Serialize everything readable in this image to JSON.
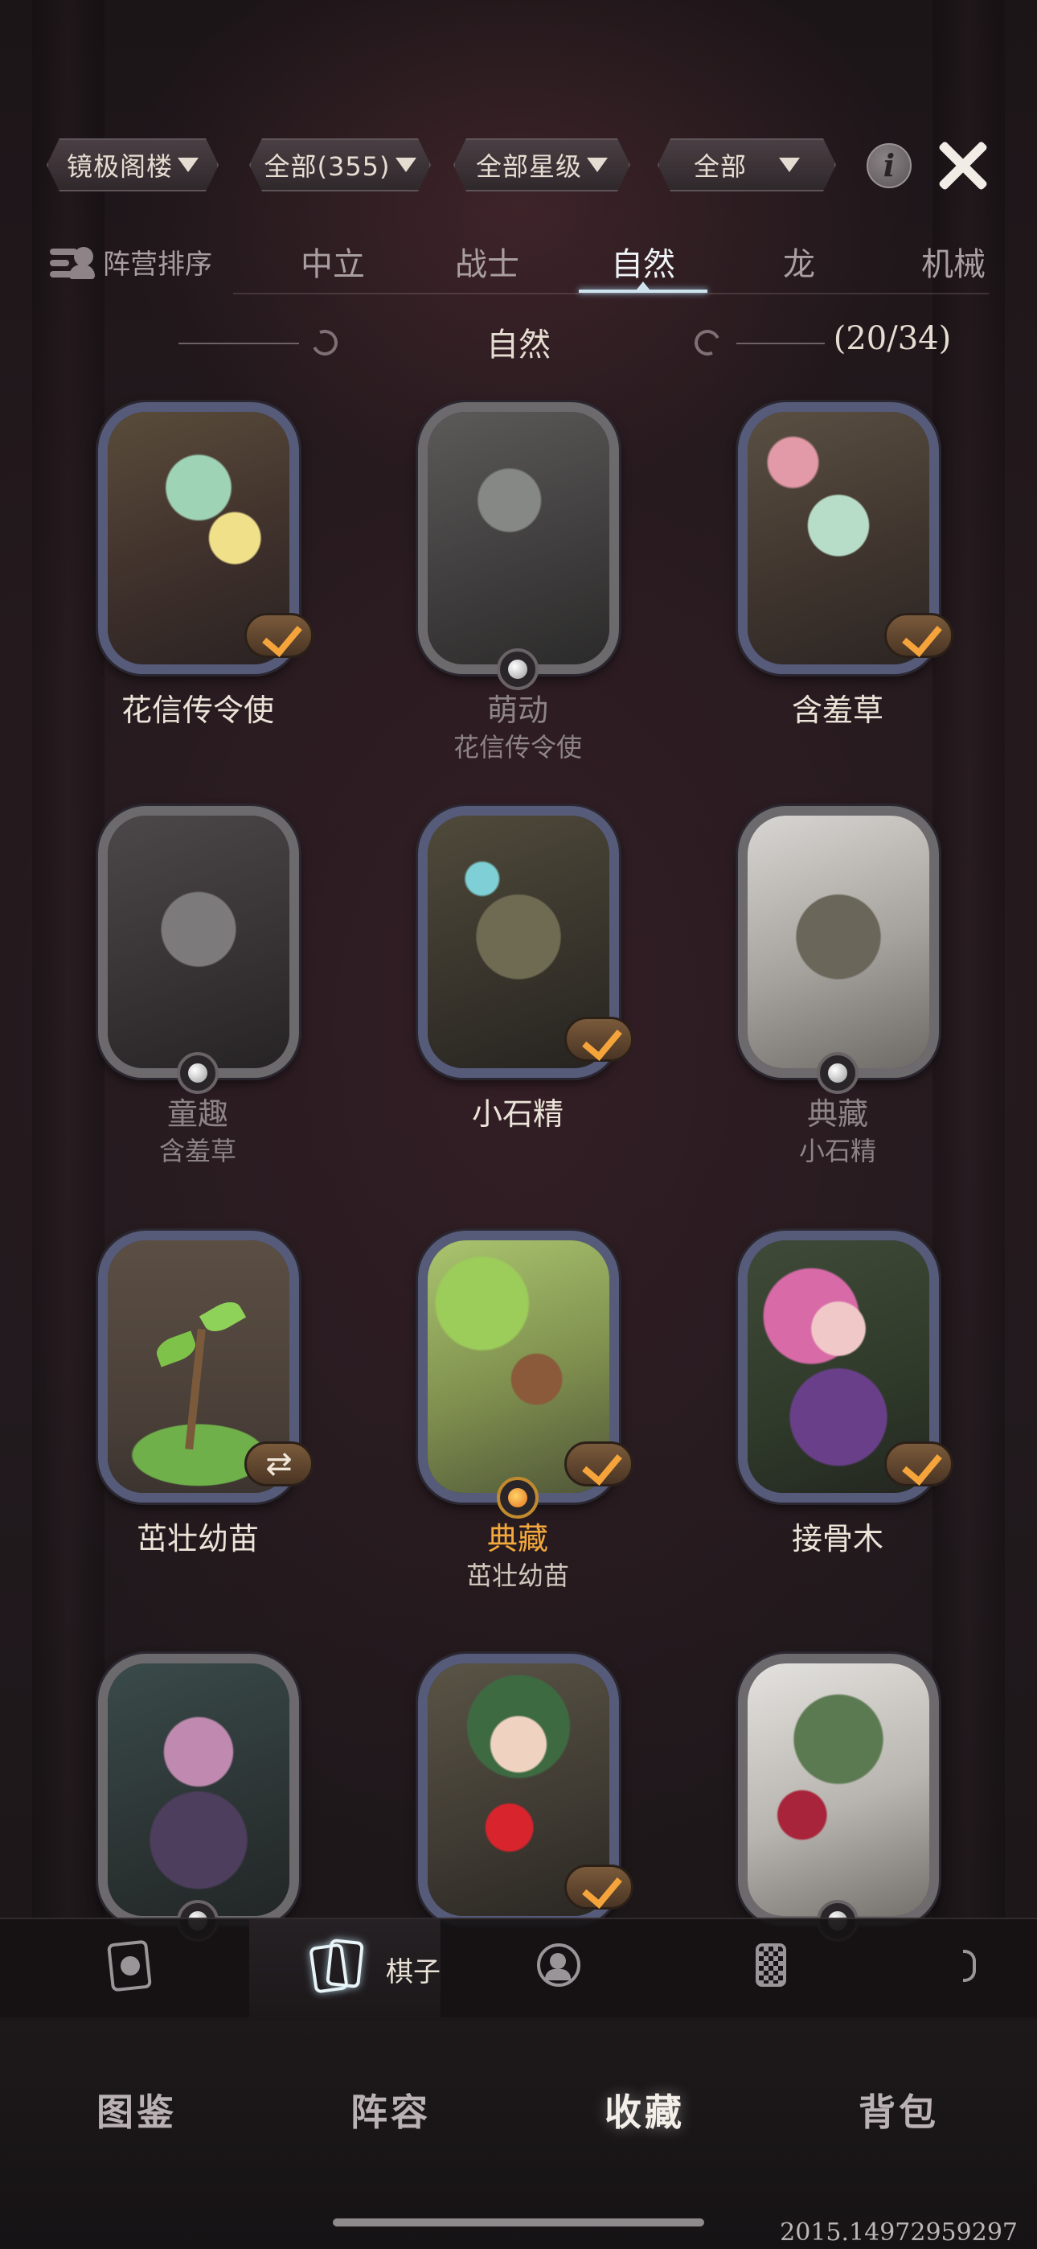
{
  "filters": [
    {
      "label": "镜极阁楼"
    },
    {
      "label": "全部(355)"
    },
    {
      "label": "全部星级"
    },
    {
      "label": "全部"
    }
  ],
  "camp_sort_label": "阵营排序",
  "tabs": [
    "中立",
    "战士",
    "自然",
    "龙",
    "机械"
  ],
  "active_tab": "自然",
  "section": {
    "title": "自然",
    "count": "(20/34)"
  },
  "cards": [
    {
      "name": "花信传令使",
      "sub": "",
      "state": "owned"
    },
    {
      "name": "萌动",
      "sub": "花信传令使",
      "state": "variant-locked"
    },
    {
      "name": "含羞草",
      "sub": "",
      "state": "owned"
    },
    {
      "name": "童趣",
      "sub": "含羞草",
      "state": "variant-locked"
    },
    {
      "name": "小石精",
      "sub": "",
      "state": "owned"
    },
    {
      "name": "典藏",
      "sub": "小石精",
      "state": "variant-locked"
    },
    {
      "name": "茁壮幼苗",
      "sub": "",
      "state": "swap"
    },
    {
      "name": "典藏",
      "sub": "茁壮幼苗",
      "state": "variant-gold-owned"
    },
    {
      "name": "接骨木",
      "sub": "",
      "state": "owned"
    },
    {
      "name": "",
      "sub": "",
      "state": "variant-locked"
    },
    {
      "name": "",
      "sub": "",
      "state": "owned"
    },
    {
      "name": "",
      "sub": "",
      "state": "variant-locked"
    }
  ],
  "subnav": {
    "active_label": "棋子",
    "icons": [
      "portrait-card-icon",
      "chess-piece-card-icon",
      "avatar-frame-icon",
      "board-icon",
      "more-icon"
    ]
  },
  "mainnav": [
    "图鉴",
    "阵容",
    "收藏",
    "背包"
  ],
  "mainnav_active": "收藏",
  "build_id": "2015.14972959297",
  "colors": {
    "accent_gold": "#f2a83c",
    "tab_active": "#eef3f6",
    "frame_blue": "#565b7a",
    "frame_gray": "#6c6a6c"
  }
}
